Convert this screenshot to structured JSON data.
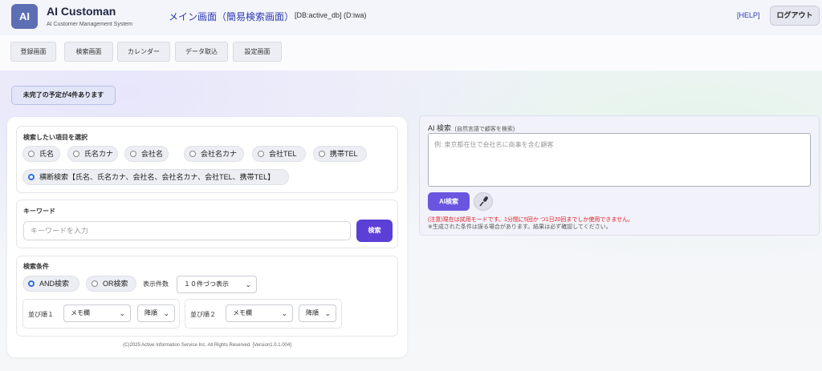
{
  "header": {
    "logo_text": "AI",
    "app_title": "AI Customan",
    "app_subtitle": "AI Customer Management System",
    "page_title": "メイン画面（簡易検索画面）",
    "db_info": "[DB:active_db] (D:iwa)",
    "help_label": "[HELP]",
    "logout_label": "ログアウト"
  },
  "nav": {
    "items": [
      "登録画面",
      "検索画面",
      "カレンダー",
      "データ取込",
      "設定画面"
    ]
  },
  "notice": "未完了の予定が4件あります",
  "search_items": {
    "title": "検索したい項目を選択",
    "options": [
      "氏名",
      "氏名カナ",
      "会社名",
      "会社名カナ",
      "会社TEL",
      "携帯TEL"
    ],
    "cross_option": "横断検索【氏名、氏名カナ、会社名、会社名カナ、会社TEL、携帯TEL】",
    "selected": "横断検索"
  },
  "keyword": {
    "title": "キーワード",
    "placeholder": "キーワードを入力",
    "button_label": "検索"
  },
  "conditions": {
    "title": "検索条件",
    "and_label": "AND検索",
    "or_label": "OR検索",
    "selected_logic": "AND検索",
    "display_count_label": "表示件数",
    "display_count_value": "１０件づつ表示",
    "sort1_label": "並び順１",
    "sort1_field": "メモ欄",
    "sort1_order": "降順",
    "sort2_label": "並び順２",
    "sort2_field": "メモ欄",
    "sort2_order": "降順"
  },
  "footer": "(C)2025 Active Information Service Inc. All Rights Reserved. [Version1.0.1.004]",
  "ai_search": {
    "title": "AI 検索",
    "subtitle": "(自然言語で顧客を検索)",
    "placeholder": "例: 東京都在住で会社名に商事を含む顧客",
    "button_label": "AI検索",
    "warning": "(注意)現在は試用モードです。1分間に5回か つ1日20回までしか使用できません。",
    "note": "※生成された条件は誤る場合があります。結果は必ず確認してください。"
  },
  "colors": {
    "accent": "#5b3fd6",
    "link": "#2b3ab0",
    "warning": "#dd2222"
  },
  "icons": {
    "mic": "microphone-icon",
    "chevron": "chevron-down-icon"
  }
}
